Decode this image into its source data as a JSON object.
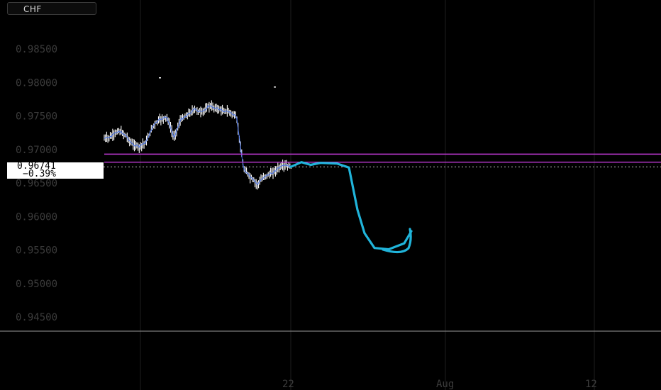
{
  "header": {
    "symbol": "CHF"
  },
  "price_scale": {
    "labels": [
      "0.98500",
      "0.98000",
      "0.97500",
      "0.97000",
      "0.96500",
      "0.96000",
      "0.95500",
      "0.95000",
      "0.94500"
    ]
  },
  "time_scale": {
    "labels": [
      "22",
      "Aug",
      "12"
    ]
  },
  "last_price": {
    "value": "0.96741",
    "change": "−0.39%"
  },
  "colors": {
    "background": "#000000",
    "candles": "#ffffff",
    "wick_accent": "#3b6cf5",
    "resistance_band": "#c13ad6",
    "projection": "#20b4da",
    "grid": "#1e1e1e",
    "axis_text": "#3c3c3c"
  },
  "chart_data": {
    "type": "line",
    "ylim": [
      0.945,
      0.985
    ],
    "y_ticks": [
      0.985,
      0.98,
      0.975,
      0.97,
      0.965,
      0.96,
      0.955,
      0.95,
      0.945
    ],
    "x_ticks": [
      "22",
      "Aug",
      "12"
    ],
    "last_value": 0.96741,
    "change_pct": -0.39,
    "series": [
      {
        "values": [
          0.9716,
          0.9719,
          0.9728,
          0.9722,
          0.9708,
          0.9704,
          0.9711,
          0.9735,
          0.9745,
          0.9748,
          0.9718,
          0.9745,
          0.9752,
          0.976,
          0.9755,
          0.9765,
          0.9762,
          0.9758,
          0.9756,
          0.9748,
          0.9672,
          0.9658,
          0.9648,
          0.966,
          0.9664,
          0.9672,
          0.9676,
          0.9674
        ]
      },
      {
        "values": [
          0.9674,
          0.9681,
          0.9677,
          0.968,
          0.9679,
          0.9673,
          0.961,
          0.9575,
          0.9553,
          0.9551,
          0.956,
          0.9578
        ]
      }
    ],
    "horizontal_levels": [
      0.9693,
      0.9681,
      0.9674
    ]
  }
}
